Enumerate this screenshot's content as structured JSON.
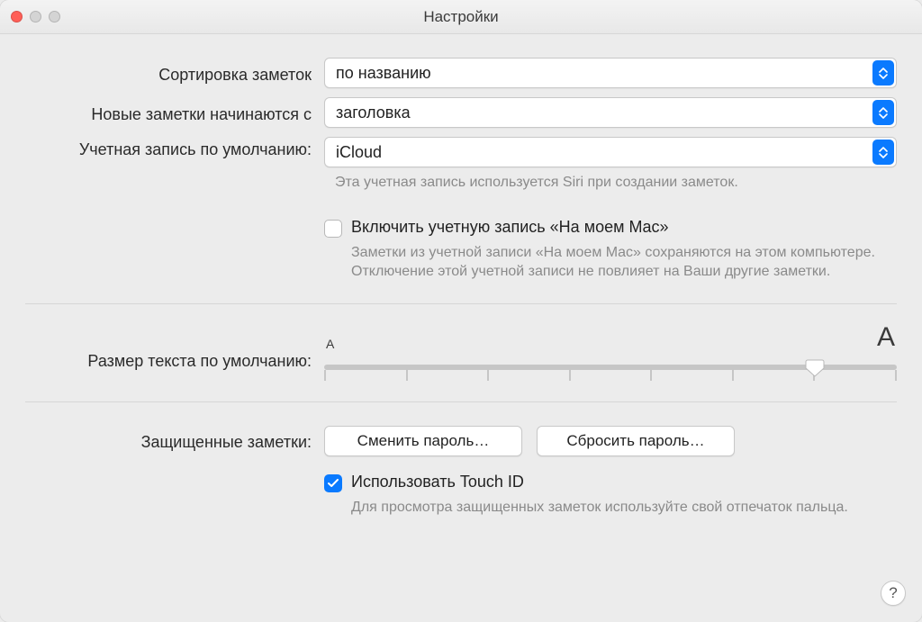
{
  "window": {
    "title": "Настройки"
  },
  "sort": {
    "label": "Сортировка заметок",
    "value": "по названию"
  },
  "newNotes": {
    "label": "Новые заметки начинаются с",
    "value": "заголовка"
  },
  "defaultAccount": {
    "label": "Учетная запись по умолчанию:",
    "value": "iCloud",
    "help": "Эта учетная запись используется Siri при создании заметок."
  },
  "onMyMac": {
    "label": "Включить учетную запись «На моем Mac»",
    "help": "Заметки из учетной записи «На моем Mac» сохраняются на этом компьютере. Отключение этой учетной записи не повлияет на Ваши другие заметки."
  },
  "textSize": {
    "label": "Размер текста по умолчанию:",
    "ticks": 8,
    "value": 6
  },
  "locked": {
    "label": "Защищенные заметки:",
    "changePassword": "Сменить пароль…",
    "resetPassword": "Сбросить пароль…"
  },
  "touchId": {
    "label": "Использовать Touch ID",
    "help": "Для просмотра защищенных заметок используйте свой отпечаток пальца.",
    "checked": true
  },
  "helpButton": "?"
}
